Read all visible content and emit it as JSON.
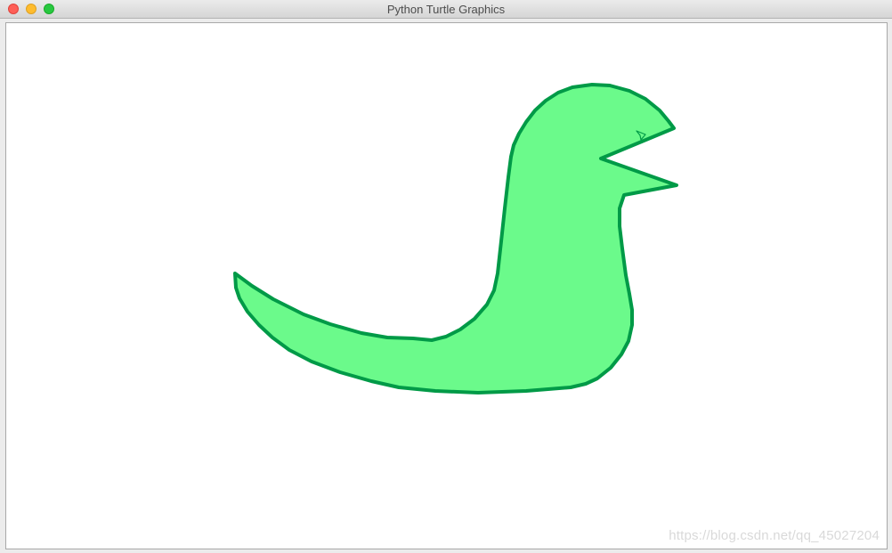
{
  "window": {
    "title": "Python Turtle Graphics"
  },
  "canvas": {
    "background": "#ffffff",
    "shape": {
      "fill": "#6bfa8b",
      "stroke": "#009a47"
    },
    "turtle_cursor": {
      "icon": "turtle-arrow-icon",
      "color": "#009a47"
    }
  },
  "watermark": {
    "text": "https://blog.csdn.net/qq_45027204"
  },
  "colors": {
    "close": "#fe5f57",
    "minimize": "#febc2e",
    "maximize": "#28c840"
  }
}
